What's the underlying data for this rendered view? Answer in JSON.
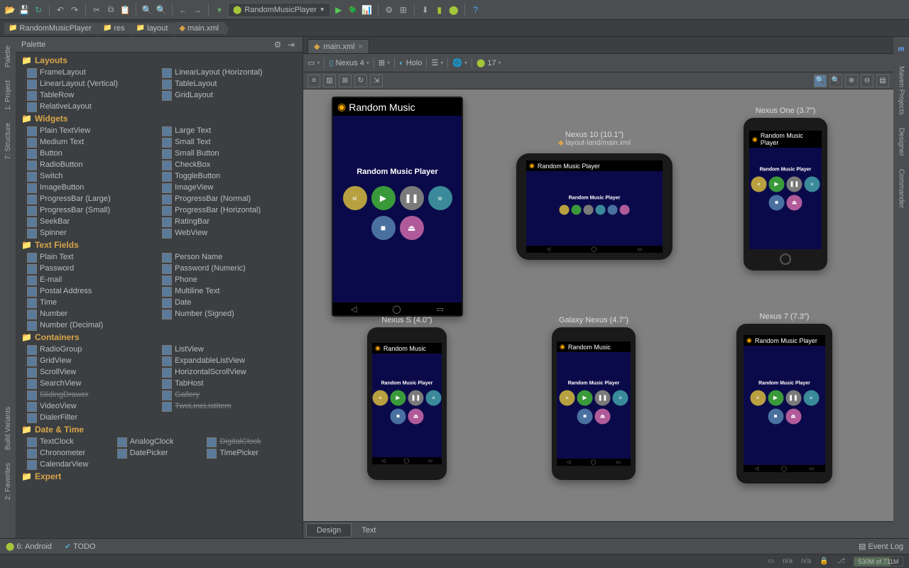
{
  "breadcrumb": [
    "RandomMusicPlayer",
    "res",
    "layout",
    "main.xml"
  ],
  "palette": {
    "title": "Palette",
    "groups": [
      {
        "name": "Layouts",
        "items": [
          "FrameLayout",
          "LinearLayout (Horizontal)",
          "LinearLayout (Vertical)",
          "TableLayout",
          "TableRow",
          "GridLayout",
          "RelativeLayout"
        ]
      },
      {
        "name": "Widgets",
        "items": [
          "Plain TextView",
          "Large Text",
          "Medium Text",
          "Small Text",
          "Button",
          "Small Button",
          "RadioButton",
          "CheckBox",
          "Switch",
          "ToggleButton",
          "ImageButton",
          "ImageView",
          "ProgressBar (Large)",
          "ProgressBar (Normal)",
          "ProgressBar (Small)",
          "ProgressBar (Horizontal)",
          "SeekBar",
          "RatingBar",
          "Spinner",
          "WebView"
        ]
      },
      {
        "name": "Text Fields",
        "items": [
          "Plain Text",
          "Person Name",
          "Password",
          "Password (Numeric)",
          "E-mail",
          "Phone",
          "Postal Address",
          "Multiline Text",
          "Time",
          "Date",
          "Number",
          "Number (Signed)",
          "Number (Decimal)"
        ]
      },
      {
        "name": "Containers",
        "items": [
          "RadioGroup",
          "ListView",
          "GridView",
          "ExpandableListView",
          "ScrollView",
          "HorizontalScrollView",
          "SearchView",
          "TabHost",
          "SlidingDrawer",
          "Gallery",
          "VideoView",
          "TwoLineListItem",
          "DialerFilter"
        ]
      },
      {
        "name": "Date & Time",
        "threecol": true,
        "items": [
          "TextClock",
          "AnalogClock",
          "DigitalClock",
          "Chronometer",
          "DatePicker",
          "TimePicker",
          "CalendarView"
        ]
      },
      {
        "name": "Expert",
        "items": []
      }
    ],
    "struck": [
      "SlidingDrawer",
      "Gallery",
      "TwoLineListItem",
      "DigitalClock"
    ]
  },
  "run_config": "RandomMusicPlayer",
  "tab": {
    "label": "main.xml"
  },
  "designer": {
    "device": "Nexus 4",
    "theme": "Holo",
    "api": "17",
    "previews": [
      {
        "label": "",
        "sublabel": "",
        "title": "Random Music",
        "big": true
      },
      {
        "label": "Nexus 10 (10.1\")",
        "sublabel": "layout-land/main.xml",
        "title": "Random Music Player",
        "land": true
      },
      {
        "label": "Nexus One (3.7\")",
        "title": "Random Music Player"
      },
      {
        "label": "Nexus S (4.0\")",
        "title": "Random Music"
      },
      {
        "label": "Galaxy Nexus (4.7\")",
        "title": "Random Music"
      },
      {
        "label": "Nexus 7 (7.3\")",
        "title": "Random Music Player"
      }
    ],
    "app_label": "Random Music Player",
    "view_tabs": [
      "Design",
      "Text"
    ]
  },
  "left_rail": [
    "Palette",
    "1: Project",
    "7: Structure",
    "Build Variants",
    "2: Favorites"
  ],
  "right_rail": [
    "Maven Projects",
    "Designer",
    "Commander"
  ],
  "bottom": {
    "left": [
      "6: Android",
      "TODO"
    ],
    "right": "Event Log"
  },
  "status": {
    "na": "n/a",
    "mem": "530M of 711M"
  }
}
